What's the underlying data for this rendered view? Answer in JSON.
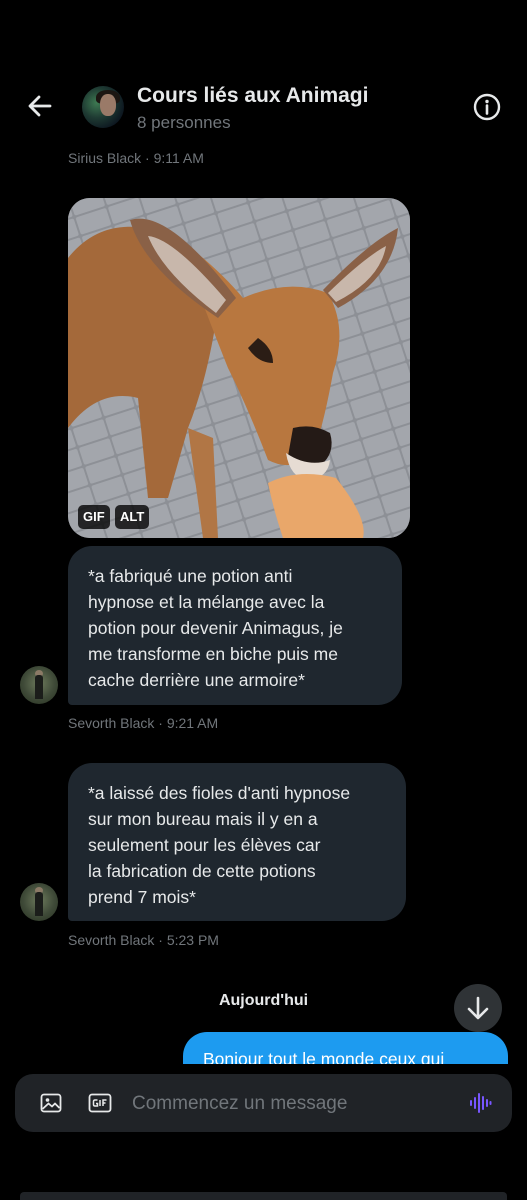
{
  "header": {
    "title": "Cours liés aux Animagi",
    "subtitle": "8 personnes"
  },
  "messages": [
    {
      "meta": "Sirius Black · 9:11 AM",
      "media_badges": [
        "GIF",
        "ALT"
      ]
    },
    {
      "lines": [
        "*a fabriqué une potion anti",
        "hypnose et la mélange avec la",
        "potion pour devenir Animagus, je",
        "me transforme en biche puis me",
        "cache derrière une armoire*"
      ],
      "meta": "Sevorth Black · 9:21 AM"
    },
    {
      "lines": [
        "*a laissé des fioles d'anti hypnose",
        "sur mon bureau mais il y en a",
        "seulement pour les élèves car",
        "la fabrication de cette potions",
        "prend 7 mois*"
      ],
      "meta": "Sevorth Black · 5:23 PM"
    }
  ],
  "day_separator": "Aujourd'hui",
  "outgoing_preview": "Bonjour tout le monde ceux qui",
  "composer": {
    "placeholder": "Commencez un message"
  },
  "colors": {
    "background": "#000000",
    "bubble_incoming": "#1f272f",
    "bubble_outgoing": "#1d9bf0",
    "voice_accent": "#7856ff"
  },
  "icons": [
    "back-arrow-icon",
    "info-icon",
    "arrow-down-icon",
    "image-icon",
    "gif-icon",
    "voice-wave-icon"
  ]
}
